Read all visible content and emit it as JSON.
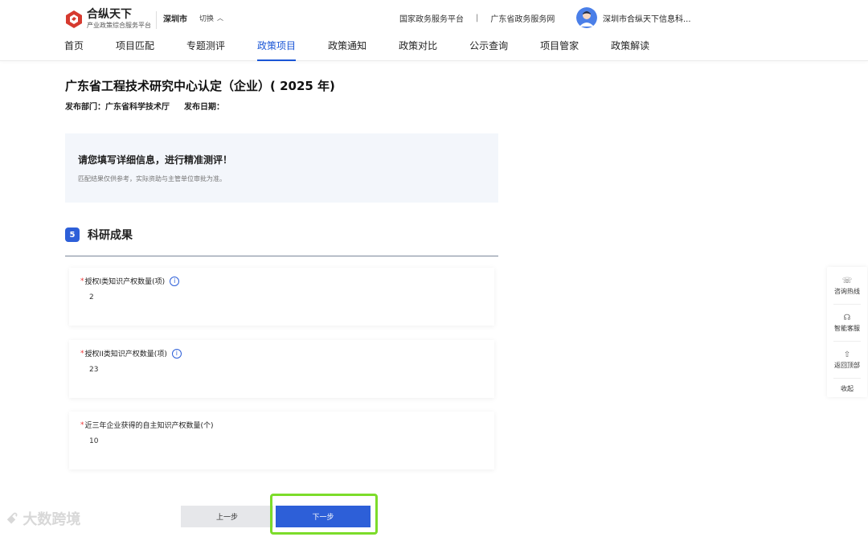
{
  "header": {
    "logo_title": "合纵天下",
    "logo_subtitle": "产业政策综合服务平台",
    "city": "深圳市",
    "switch_label": "切换",
    "top_links": [
      "国家政务服务平台",
      "广东省政务服务网"
    ],
    "separator": "|",
    "user_name": "深圳市合纵天下信息科..."
  },
  "nav": {
    "items": [
      "首页",
      "项目匹配",
      "专题测评",
      "政策项目",
      "政策通知",
      "政策对比",
      "公示查询",
      "项目管家",
      "政策解读"
    ],
    "active_index": 3
  },
  "policy": {
    "title": "广东省工程技术研究中心认定（企业）( 2025 年)",
    "department": "发布部门：广东省科学技术厅",
    "date": "发布日期："
  },
  "notice": {
    "title": "请您填写详细信息，进行精准测评！",
    "text": "匹配结果仅供参考，实际资助与主管单位审批为准。"
  },
  "section": {
    "number": "5",
    "title": "科研成果"
  },
  "fields": [
    {
      "label": "授权I类知识产权数量(项)",
      "value": "2",
      "has_info": true
    },
    {
      "label": "授权II类知识产权数量(项)",
      "value": "23",
      "has_info": true
    },
    {
      "label": "近三年企业获得的自主知识产权数量(个)",
      "value": "10",
      "has_info": false
    }
  ],
  "tools": {
    "hotline": "咨询热线",
    "service": "智能客服",
    "top": "返回顶部",
    "collapse": "收起"
  },
  "buttons": {
    "prev": "上一步",
    "next": "下一步"
  },
  "watermark": "大数跨境",
  "colors": {
    "primary": "#2d5fd8",
    "highlight": "#7cdc2a",
    "required": "#e33333"
  }
}
